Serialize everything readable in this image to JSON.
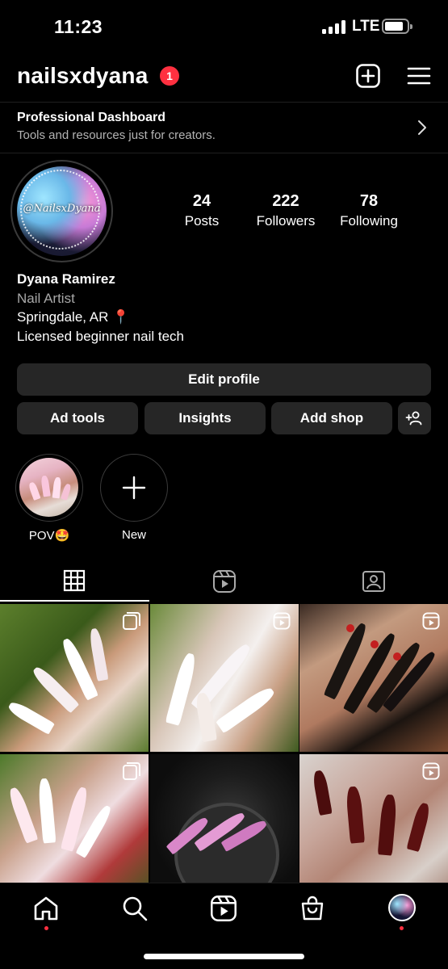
{
  "status_bar": {
    "time": "11:23",
    "network": "LTE"
  },
  "header": {
    "username": "nailsxdyana",
    "notification_count": "1",
    "icons": [
      "plus-square-icon",
      "hamburger-menu-icon"
    ]
  },
  "dashboard": {
    "title": "Professional Dashboard",
    "subtitle": "Tools and resources just for creators."
  },
  "profile": {
    "avatar_text": "@NailsxDyana",
    "stats": [
      {
        "value": "24",
        "label": "Posts"
      },
      {
        "value": "222",
        "label": "Followers"
      },
      {
        "value": "78",
        "label": "Following"
      }
    ],
    "name": "Dyana Ramirez",
    "category": "Nail Artist",
    "location": "Springdale, AR",
    "location_emoji": "📍",
    "bio": "Licensed beginner nail tech"
  },
  "buttons": {
    "edit_profile": "Edit profile",
    "ad_tools": "Ad tools",
    "insights": "Insights",
    "add_shop": "Add shop"
  },
  "highlights": [
    {
      "label": "POV🤩"
    },
    {
      "label": "New"
    }
  ],
  "tabs": [
    "grid-icon",
    "reels-icon",
    "tagged-icon"
  ],
  "posts": [
    {
      "type": "carousel"
    },
    {
      "type": "reel"
    },
    {
      "type": "reel"
    },
    {
      "type": "carousel"
    },
    {
      "type": "image"
    },
    {
      "type": "reel"
    }
  ],
  "bottom_nav": [
    "home-icon",
    "search-icon",
    "reels-icon",
    "shop-icon",
    "profile-avatar"
  ],
  "colors": {
    "background": "#000000",
    "button": "#262626",
    "badge": "#ff3040",
    "muted_text": "#a8a8a8"
  }
}
